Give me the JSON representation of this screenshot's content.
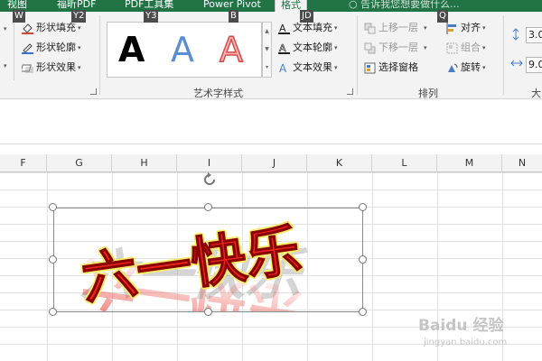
{
  "tabs": [
    {
      "label": "视图",
      "key": "W"
    },
    {
      "label": "福昕PDF",
      "key": "Y2"
    },
    {
      "label": "PDF工具集",
      "key": "Y3"
    },
    {
      "label": "Power Pivot",
      "key": "B"
    },
    {
      "label": "格式",
      "key": "JD"
    }
  ],
  "tellme": {
    "text": "告诉我您想要做什么...",
    "key": "Q"
  },
  "shape_styles": {
    "fill_label": "形状填充",
    "outline_label": "形状轮廓",
    "effects_label": "形状效果"
  },
  "wordart": {
    "samples": [
      "A",
      "A",
      "A"
    ],
    "fill_label": "文本填充",
    "outline_label": "文本轮廓",
    "effects_label": "文本效果",
    "group_label": "艺术字样式"
  },
  "arrange": {
    "bring_forward": "上移一层",
    "send_backward": "下移一层",
    "selection_pane": "选择窗格",
    "align": "对齐",
    "group": "组合",
    "rotate": "旋转",
    "group_label": "排列"
  },
  "size": {
    "height": "3.0",
    "width": "9.0",
    "group_label": "大"
  },
  "columns": [
    "F",
    "G",
    "H",
    "I",
    "J",
    "K",
    "L",
    "M",
    "N"
  ],
  "wordart_text": "六一快乐",
  "watermark": {
    "brand": "Baidu 经验",
    "url": "jingyan.baidu.com"
  },
  "colors": {
    "ribbon_green": "#217346",
    "art_red": "#e8281e",
    "art_dark": "#8a0000"
  }
}
